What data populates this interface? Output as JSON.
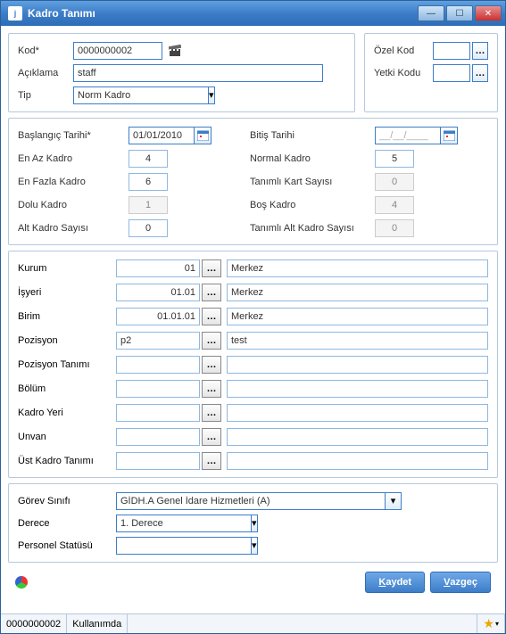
{
  "titlebar": {
    "title": "Kadro Tanımı"
  },
  "section1": {
    "kod_label": "Kod*",
    "kod_value": "0000000002",
    "aciklama_label": "Açıklama",
    "aciklama_value": "staff",
    "tip_label": "Tip",
    "tip_value": "Norm Kadro",
    "ozelkod_label": "Özel Kod",
    "ozelkod_value": "",
    "yetki_label": "Yetki Kodu",
    "yetki_value": ""
  },
  "section2": {
    "baslangic_label": "Başlangıç Tarihi*",
    "baslangic_value": "01/01/2010",
    "bitis_label": "Bitiş Tarihi",
    "bitis_value": "__/__/____",
    "enaz_label": "En Az Kadro",
    "enaz_value": "4",
    "normal_label": "Normal Kadro",
    "normal_value": "5",
    "enfazla_label": "En Fazla Kadro",
    "enfazla_value": "6",
    "tanimlikart_label": "Tanımlı Kart Sayısı",
    "tanimlikart_value": "0",
    "dolu_label": "Dolu Kadro",
    "dolu_value": "1",
    "bos_label": "Boş Kadro",
    "bos_value": "4",
    "alt_label": "Alt Kadro Sayısı",
    "alt_value": "0",
    "tanimlialt_label": "Tanımlı Alt Kadro Sayısı",
    "tanimlialt_value": "0"
  },
  "section3": {
    "rows": [
      {
        "label": "Kurum",
        "code": "01",
        "desc": "Merkez",
        "align": "right"
      },
      {
        "label": "İşyeri",
        "code": "01.01",
        "desc": "Merkez",
        "align": "right"
      },
      {
        "label": "Birim",
        "code": "01.01.01",
        "desc": "Merkez",
        "align": "right"
      },
      {
        "label": "Pozisyon",
        "code": "p2",
        "desc": "test",
        "align": "left"
      },
      {
        "label": "Pozisyon Tanımı",
        "code": "",
        "desc": "",
        "align": "left"
      },
      {
        "label": "Bölüm",
        "code": "",
        "desc": "",
        "align": "left"
      },
      {
        "label": "Kadro Yeri",
        "code": "",
        "desc": "",
        "align": "left"
      },
      {
        "label": "Unvan",
        "code": "",
        "desc": "",
        "align": "left"
      },
      {
        "label": "Üst Kadro Tanımı",
        "code": "",
        "desc": "",
        "align": "left"
      }
    ]
  },
  "section4": {
    "gorev_label": "Görev Sınıfı",
    "gorev_value": "GİDH.A Genel İdare Hizmetleri (A)",
    "derece_label": "Derece",
    "derece_value": "1. Derece",
    "statu_label": "Personel Statüsü",
    "statu_value": ""
  },
  "buttons": {
    "save": "Kaydet",
    "cancel": "Vazgeç"
  },
  "status": {
    "code": "0000000002",
    "state": "Kullanımda"
  }
}
